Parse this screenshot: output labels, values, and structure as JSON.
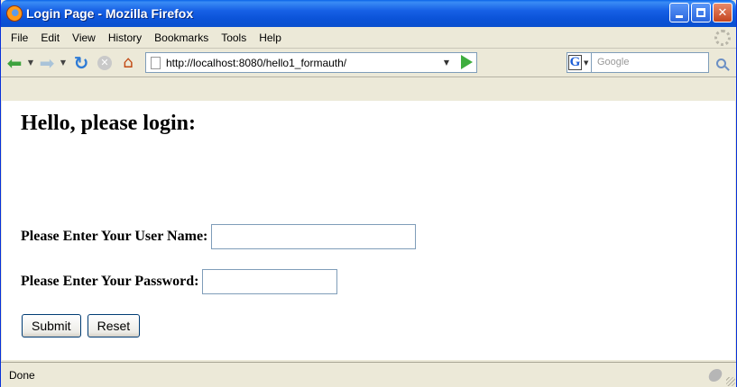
{
  "window": {
    "title": "Login Page - Mozilla Firefox"
  },
  "menu": {
    "items": [
      {
        "first": "F",
        "rest": "ile"
      },
      {
        "first": "E",
        "rest": "dit"
      },
      {
        "first": "V",
        "rest": "iew"
      },
      {
        "first": "",
        "rest": "History",
        "mid": "s"
      },
      {
        "first": "B",
        "rest": "ookmarks"
      },
      {
        "first": "T",
        "rest": "ools"
      },
      {
        "first": "H",
        "rest": "elp"
      }
    ],
    "labels": [
      "File",
      "Edit",
      "View",
      "History",
      "Bookmarks",
      "Tools",
      "Help"
    ]
  },
  "navigation": {
    "url": "http://localhost:8080/hello1_formauth/",
    "search_placeholder": "Google",
    "search_engine_letter": "G"
  },
  "page": {
    "heading": "Hello, please login:",
    "username_label": "Please Enter Your User Name:",
    "password_label": "Please Enter Your Password:",
    "username_value": "",
    "password_value": "",
    "submit_label": "Submit",
    "reset_label": "Reset"
  },
  "status": {
    "text": "Done"
  },
  "colors": {
    "titlebar": "#0b53d8",
    "chrome": "#ece9d8",
    "field_border": "#7f9db9"
  }
}
